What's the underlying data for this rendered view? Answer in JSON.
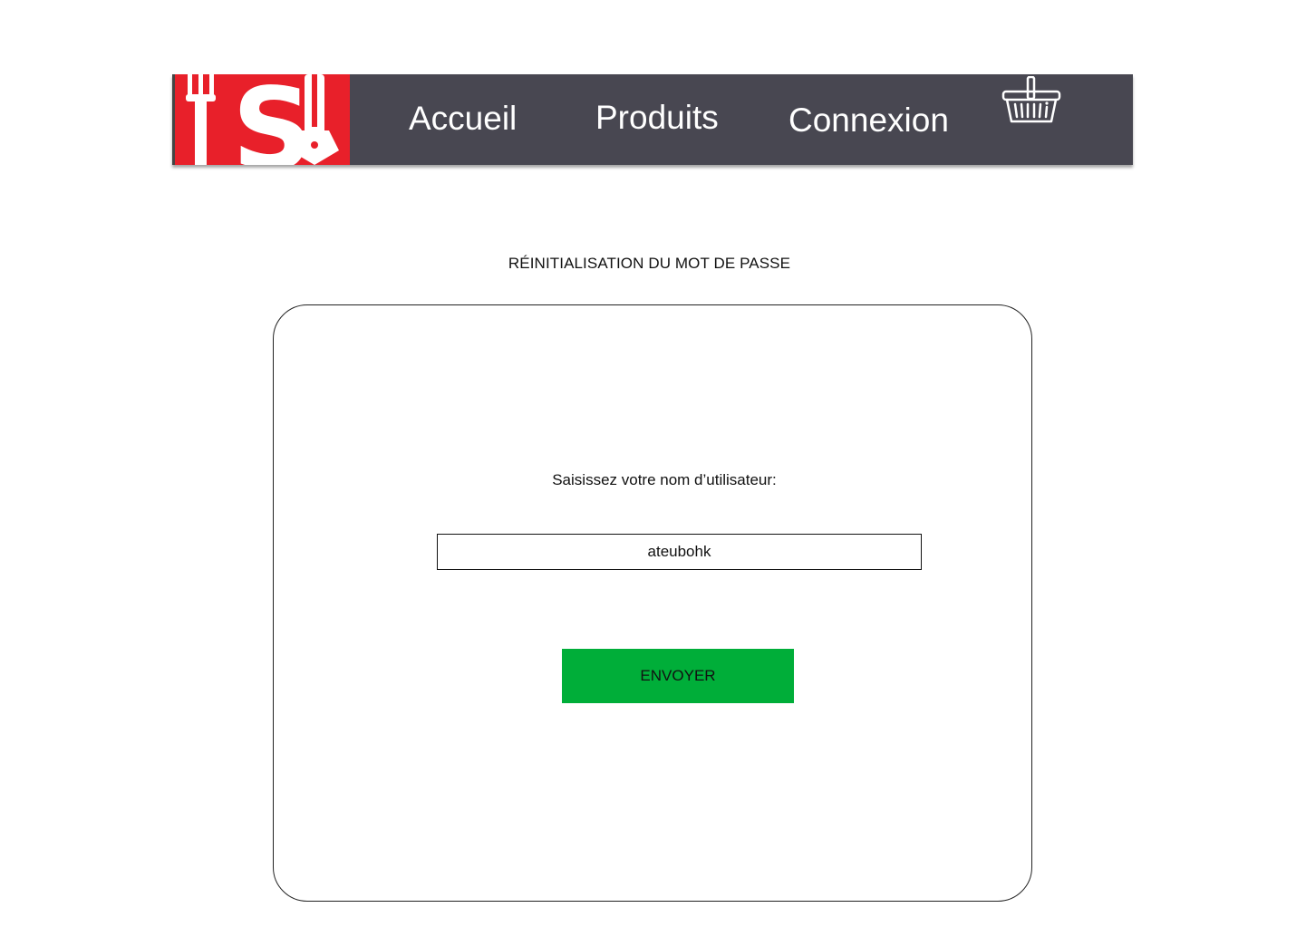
{
  "nav": {
    "links": [
      {
        "label": "Accueil"
      },
      {
        "label": "Produits"
      },
      {
        "label": "Connexion"
      }
    ],
    "cart_icon": "basket-icon",
    "logo_icon": "restaurant-logo",
    "logo_letter": "S"
  },
  "page": {
    "title": "RÉINITIALISATION DU MOT DE PASSE"
  },
  "form": {
    "prompt": "Saisissez votre nom d’utilisateur:",
    "username_value": "ateubohk",
    "submit_label": "ENVOYER"
  },
  "colors": {
    "navbar": "#484751",
    "logo_red": "#e8202a",
    "button_green": "#00ae39"
  }
}
